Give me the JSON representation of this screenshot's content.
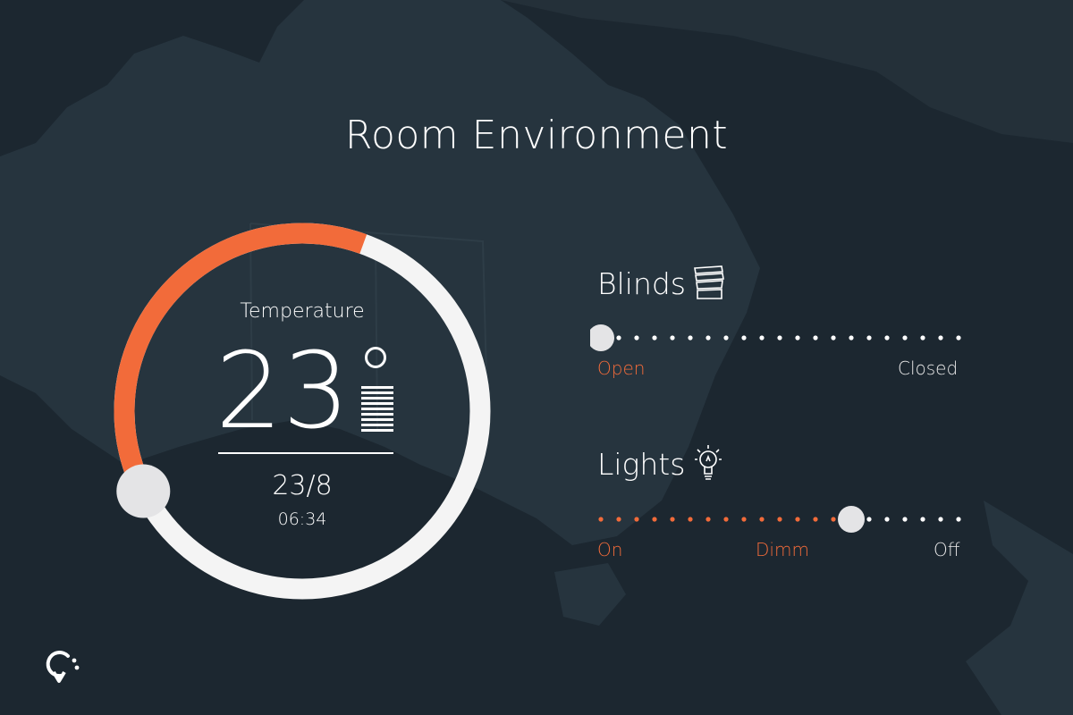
{
  "page": {
    "title": "Room Environment"
  },
  "colors": {
    "accent": "#f26b3a",
    "track": "#f4f4f4",
    "knob": "#e4e4e6",
    "background": "#1c2730",
    "map": "#26343e"
  },
  "temperature": {
    "label": "Temperature",
    "value": "23",
    "date": "23/8",
    "time": "06:34",
    "level": 0.38
  },
  "blinds": {
    "title": "Blinds",
    "icon": "blinds-icon",
    "labels": {
      "start": "Open",
      "end": "Closed"
    },
    "level": 0.0,
    "dot_count": 21
  },
  "lights": {
    "title": "Lights",
    "icon": "lightbulb-icon",
    "labels": {
      "start": "On",
      "mid": "Dimm",
      "end": "Off"
    },
    "level": 0.7,
    "dot_count": 21
  },
  "logo": {
    "icon": "refresh-logo-icon"
  }
}
